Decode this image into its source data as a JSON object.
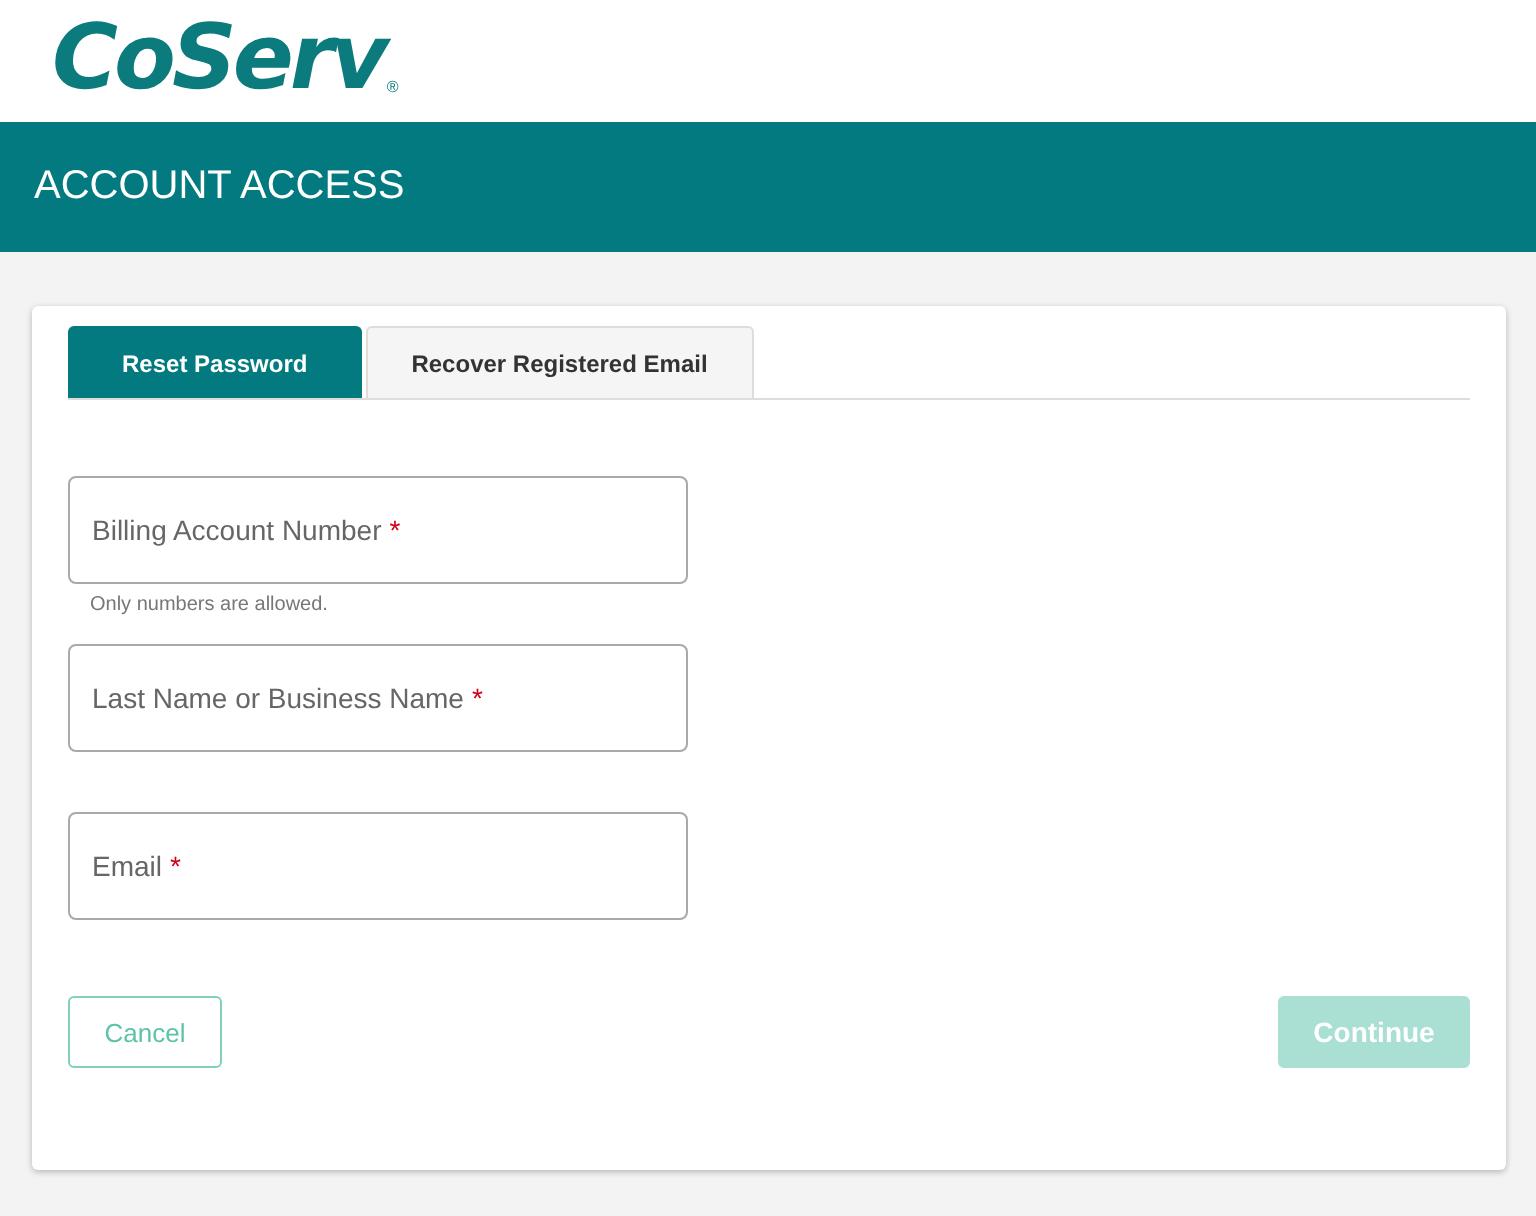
{
  "logo": {
    "text": "CoServ",
    "mark": "®"
  },
  "page_title": "ACCOUNT ACCESS",
  "tabs": [
    {
      "label": "Reset Password",
      "selected": true
    },
    {
      "label": "Recover Registered Email",
      "selected": false
    }
  ],
  "fields": [
    {
      "placeholder": "Billing Account Number",
      "required": true,
      "required_mark": "*",
      "hint": "Only numbers are allowed."
    },
    {
      "placeholder": "Last Name or Business Name",
      "required": true,
      "required_mark": "*"
    },
    {
      "placeholder": "Email",
      "required": true,
      "required_mark": "*"
    }
  ],
  "buttons": [
    {
      "label": "Cancel",
      "kind": "outline",
      "disabled": false
    },
    {
      "label": "Continue",
      "kind": "primary",
      "disabled": true
    }
  ]
}
